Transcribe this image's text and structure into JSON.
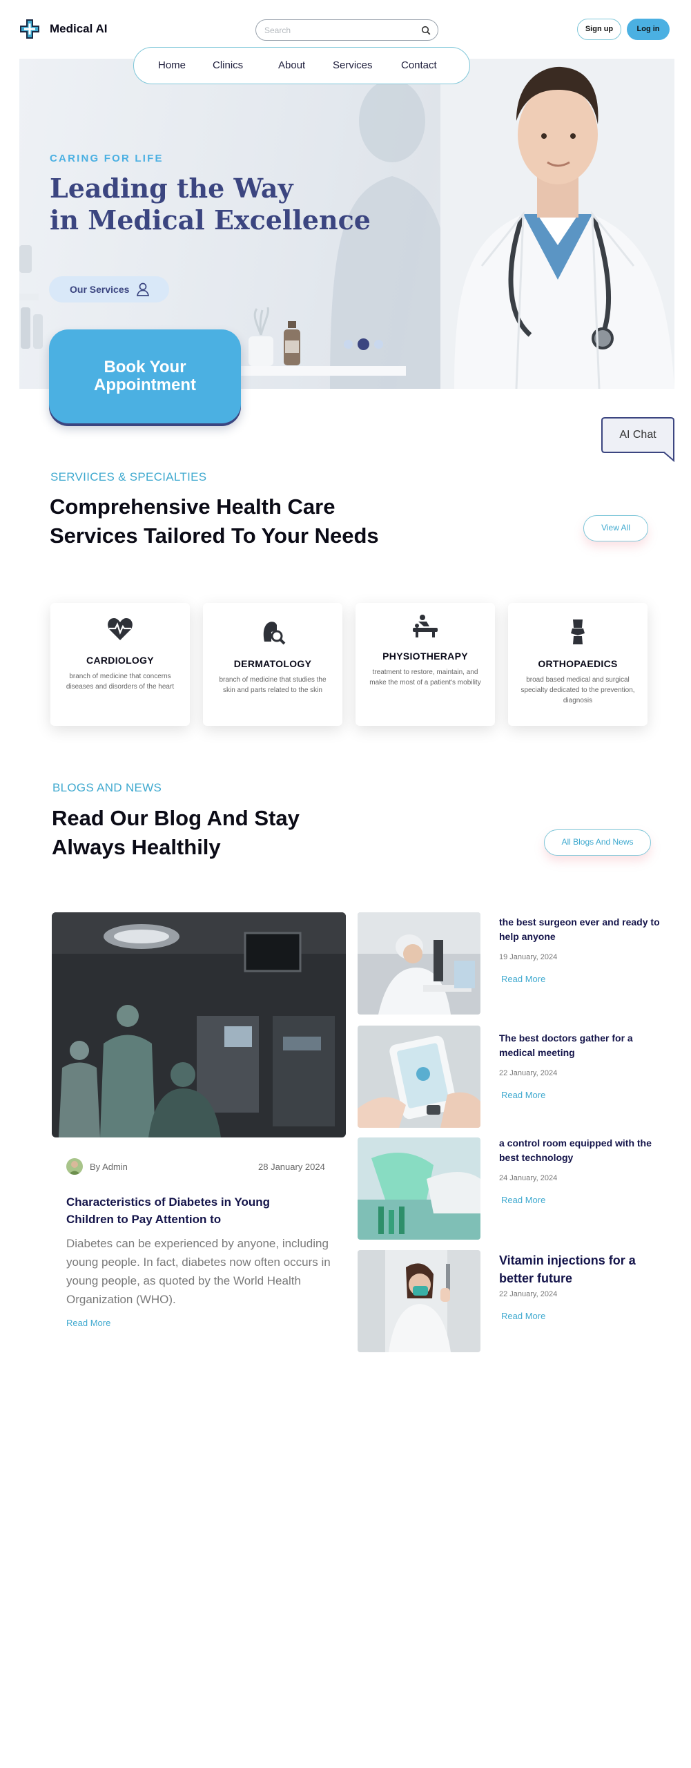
{
  "header": {
    "brand": "Medical AI",
    "search_placeholder": "Search",
    "signup_label": "Sign up",
    "login_label": "Log in",
    "accent_color": "#4bb0e2",
    "brand_color": "#3b4580"
  },
  "nav": {
    "items": [
      "Home",
      "Clinics",
      "About",
      "Services",
      "Contact"
    ]
  },
  "hero": {
    "tagline": "CARING FOR LIFE",
    "headline_line1": "Leading the Way",
    "headline_line2": "in Medical Excellence",
    "services_button": "Our Services",
    "book_line1": "Book Your",
    "book_line2": "Appointment",
    "carousel_active_index": 1
  },
  "ai_chat": {
    "label": "AI Chat"
  },
  "services": {
    "eyebrow": "SERVIICES & SPECIALTIES",
    "title_line1": "Comprehensive Health Care",
    "title_line2": "Services Tailored To Your Needs",
    "view_all": "View All",
    "cards": [
      {
        "icon": "heart-pulse-icon",
        "title": "CARDIOLOGY",
        "description": "branch of medicine that concerns diseases and disorders of the heart"
      },
      {
        "icon": "skin-magnifier-icon",
        "title": "DERMATOLOGY",
        "description": "branch of medicine that studies the skin and parts related to the skin"
      },
      {
        "icon": "physio-massage-icon",
        "title": "PHYSIOTHERAPY",
        "description": "treatment to restore, maintain, and make the most of a patient's mobility"
      },
      {
        "icon": "knee-joint-icon",
        "title": "ORTHOPAEDICS",
        "description": "broad based medical and surgical specialty dedicated to the prevention, diagnosis"
      }
    ]
  },
  "blog": {
    "eyebrow": "BLOGS AND NEWS",
    "title_line1": "Read Our Blog And Stay",
    "title_line2": "Always Healthily",
    "all_button": "All Blogs And News",
    "featured": {
      "author": "By Admin",
      "date": "28 January 2024",
      "title": "Characteristics of Diabetes in Young Children to Pay Attention to",
      "excerpt": "Diabetes can be experienced by anyone, including young people. In fact, diabetes now often occurs in young people, as quoted by the World Health Organization (WHO).",
      "read_more": "Read More"
    },
    "posts": [
      {
        "title": "the best surgeon ever and ready to help anyone",
        "date": "19 January, 2024",
        "read_more": "Read More"
      },
      {
        "title": "The best doctors gather for a medical meeting",
        "date": "22 January, 2024",
        "read_more": "Read More"
      },
      {
        "title": "a control room equipped with the best technology",
        "date": "24 January, 2024",
        "read_more": "Read More"
      },
      {
        "title": "Vitamin injections for a better future",
        "date": "22 January, 2024",
        "read_more": "Read More"
      }
    ]
  }
}
